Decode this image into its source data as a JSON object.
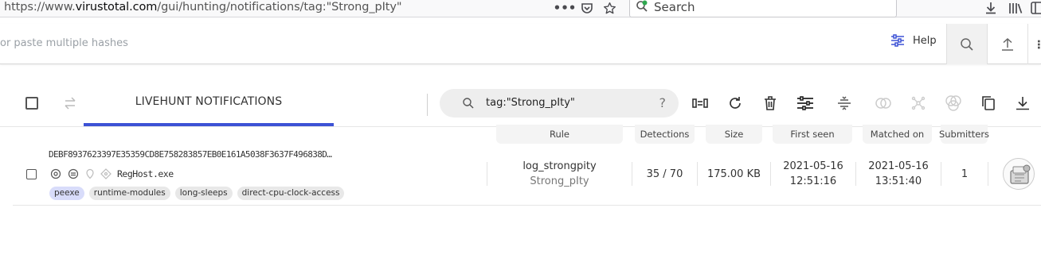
{
  "browser": {
    "url_prefix": "https://www.",
    "url_domain": "virustotal.com",
    "url_path": "/gui/hunting/notifications/tag:\"Strong_pIty\"",
    "search_placeholder": "Search"
  },
  "header": {
    "search_placeholder": "or paste multiple hashes",
    "help_label": "Help"
  },
  "toolbar": {
    "tab_label": "LIVEHUNT NOTIFICATIONS",
    "query": "tag:\"Strong_pIty\"",
    "help_mark": "?"
  },
  "table": {
    "columns": [
      "Rule",
      "Detections",
      "Size",
      "First seen",
      "Matched on",
      "Submitters"
    ],
    "rows": [
      {
        "hash": "DEBF8937623397E35359CD8E758283857EB0E161A5038F3637F496838D…",
        "filename": "RegHost.exe",
        "tags": [
          "peexe",
          "runtime-modules",
          "long-sleeps",
          "direct-cpu-clock-access"
        ],
        "rule": "log_strongpity",
        "rule_sub": "Strong_pIty",
        "detections": "35 / 70",
        "size": "175.00 KB",
        "first_seen_date": "2021-05-16",
        "first_seen_time": "12:51:16",
        "matched_date": "2021-05-16",
        "matched_time": "13:51:40",
        "submitters": "1"
      }
    ]
  },
  "colors": {
    "accent": "#3d52d5",
    "tag_highlight": "#d8dcfa"
  }
}
